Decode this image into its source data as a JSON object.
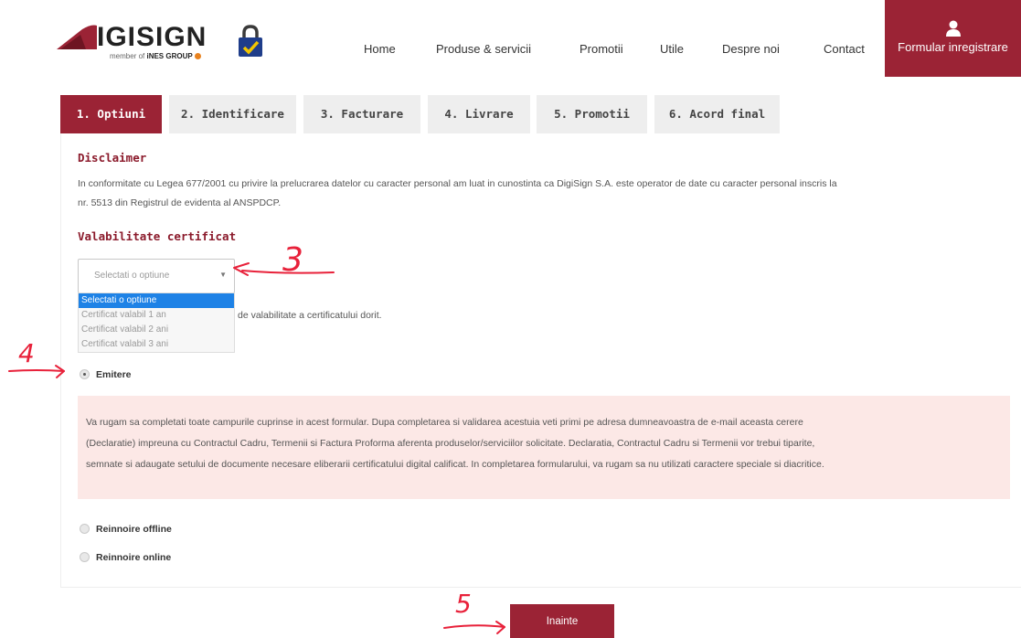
{
  "header": {
    "logo_text": "IGISIGN",
    "logo_sub_prefix": "member of ",
    "logo_sub_brand": "iNES GROUP",
    "nav": [
      "Home",
      "Produse & servicii",
      "Promotii",
      "Utile",
      "Despre noi",
      "Contact"
    ],
    "register_label": "Formular inregistrare"
  },
  "tabs": [
    "1. Optiuni",
    "2. Identificare",
    "3. Facturare",
    "4. Livrare",
    "5. Promotii",
    "6. Acord final"
  ],
  "active_tab": 0,
  "disclaimer": {
    "title": "Disclaimer",
    "text_line1": "In conformitate cu Legea 677/2001 cu privire la prelucrarea datelor cu caracter personal am luat in cunostinta ca DigiSign S.A. este operator de date cu caracter personal inscris la",
    "text_line2": "nr. 5513 din Registrul de evidenta al ANSPDCP."
  },
  "validity": {
    "title": "Valabilitate certificat",
    "selected": "Selectati o optiune",
    "options": [
      "Selectati o optiune",
      "Certificat valabil 1 an",
      "Certificat valabil 2 ani",
      "Certificat valabil 3 ani"
    ],
    "helper_text": "de valabilitate a certificatului dorit."
  },
  "radios": {
    "emitere": "Emitere",
    "offline": "Reinnoire offline",
    "online": "Reinnoire online"
  },
  "alert": {
    "line1": "Va rugam sa completati toate campurile cuprinse in acest formular. Dupa completarea si validarea acestuia veti primi pe adresa dumneavoastra de e-mail aceasta cerere",
    "line2": "(Declaratie) impreuna cu Contractul Cadru, Termenii si Factura Proforma aferenta produselor/serviciilor solicitate. Declaratia, Contractul Cadru si Termenii vor trebui tiparite,",
    "line3": "semnate si adaugate setului de documente necesare eliberarii certificatului digital calificat. In completarea formularului, va rugam sa nu utilizati caractere speciale si diacritice."
  },
  "next_button": "Inainte",
  "annotations": [
    "3",
    "4",
    "5"
  ],
  "colors": {
    "brand": "#9b2335",
    "alert_bg": "#fce8e6",
    "selected_option": "#1e82e6",
    "annotation": "#e8213a"
  }
}
